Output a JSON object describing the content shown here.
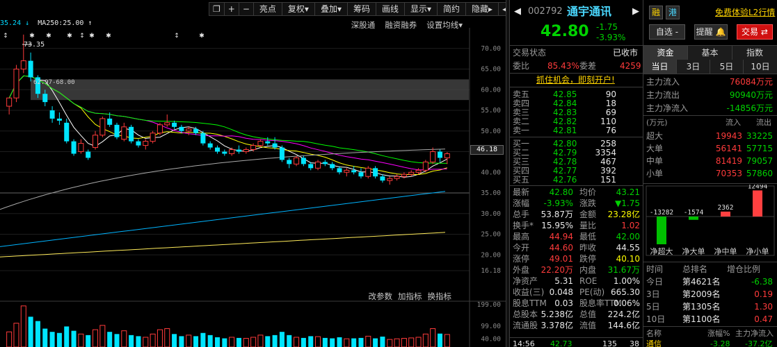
{
  "toolbar": {
    "items": [
      "亮点",
      "复权▾",
      "叠加▾",
      "筹码",
      "画线",
      "显示▾",
      "简约",
      "隐藏▸"
    ],
    "icons": [
      "window-restore-icon",
      "plus-icon",
      "minus-icon"
    ],
    "prev_label": "◂",
    "next_label": "▸"
  },
  "ma_legend": {
    "ma_prefix": "35.24 ↓",
    "ma250": "MA250:25.00 ↑"
  },
  "chart_links": [
    "深股通",
    "融资融券",
    "设置均线▾"
  ],
  "sub_links": [
    "改参数",
    "加指标",
    "换指标"
  ],
  "stock": {
    "code": "002792",
    "name": "通宇通讯",
    "badge1": "融",
    "badge2": "港",
    "price": "42.80",
    "change": "-1.75",
    "change_pct": "-3.93%",
    "promo": "免费体验L2行情",
    "btn_watch": "自选 -",
    "btn_alert": "提醒",
    "btn_trade": "交易"
  },
  "status": {
    "label": "交易状态",
    "value": "已收市",
    "weibi_label": "委比",
    "weibi_value": "85.43%",
    "weicha_label": "委差",
    "weicha_value": "4259",
    "ad": "抓住机会，即刻开户!"
  },
  "order_book": {
    "asks": [
      {
        "label": "卖五",
        "price": "42.85",
        "vol": "90"
      },
      {
        "label": "卖四",
        "price": "42.84",
        "vol": "18"
      },
      {
        "label": "卖三",
        "price": "42.83",
        "vol": "69"
      },
      {
        "label": "卖二",
        "price": "42.82",
        "vol": "110"
      },
      {
        "label": "卖一",
        "price": "42.81",
        "vol": "76"
      }
    ],
    "bids": [
      {
        "label": "买一",
        "price": "42.80",
        "vol": "258"
      },
      {
        "label": "买二",
        "price": "42.79",
        "vol": "3354"
      },
      {
        "label": "买三",
        "price": "42.78",
        "vol": "467"
      },
      {
        "label": "买四",
        "price": "42.77",
        "vol": "392"
      },
      {
        "label": "买五",
        "price": "42.76",
        "vol": "151"
      }
    ]
  },
  "stats": [
    {
      "l1": "最新",
      "v1": "42.80",
      "l2": "均价",
      "v2": "43.21"
    },
    {
      "l1": "涨幅",
      "v1": "-3.93%",
      "l2": "涨跌",
      "v2": "▼1.75"
    },
    {
      "l1": "总手",
      "v1": "53.87万",
      "l2": "金额",
      "v2": "23.28亿"
    },
    {
      "l1": "换手*",
      "v1": "15.95%",
      "l2": "量比",
      "v2": "1.02"
    },
    {
      "l1": "最高",
      "v1": "44.94",
      "l2": "最低",
      "v2": "42.00"
    },
    {
      "l1": "今开",
      "v1": "44.60",
      "l2": "昨收",
      "v2": "44.55"
    },
    {
      "l1": "涨停",
      "v1": "49.01",
      "l2": "跌停",
      "v2": "40.10"
    },
    {
      "l1": "外盘",
      "v1": "22.20万",
      "l2": "内盘",
      "v2": "31.67万"
    },
    {
      "l1": "净资产",
      "v1": "5.31",
      "l2": "ROE",
      "v2": "1.00%"
    },
    {
      "l1": "收益(三)",
      "v1": "0.048",
      "l2": "PE(动)",
      "v2": "665.30"
    },
    {
      "l1": "股息TTM",
      "v1": "0.03",
      "l2": "股息率TTM",
      "v2": "0.06%"
    },
    {
      "l1": "总股本",
      "v1": "5.238亿",
      "l2": "总值",
      "v2": "224.2亿"
    },
    {
      "l1": "流通股",
      "v1": "3.378亿",
      "l2": "流值",
      "v2": "144.6亿"
    }
  ],
  "tick": {
    "time": "14:56",
    "price": "42.73",
    "vol": "135",
    "num": "38"
  },
  "funds": {
    "tabs": [
      "资金",
      "基本",
      "指数"
    ],
    "period_tabs": [
      "当日",
      "3日",
      "5日",
      "10日"
    ],
    "main_in_label": "主力流入",
    "main_in_value": "76084万元",
    "main_out_label": "主力流出",
    "main_out_value": "90940万元",
    "main_net_label": "主力净流入",
    "main_net_value": "-14856万元",
    "table_header": [
      "(万元)",
      "流入",
      "流出"
    ],
    "rows": [
      {
        "label": "超大",
        "in": "19943",
        "out": "33225"
      },
      {
        "label": "大单",
        "in": "56141",
        "out": "57715"
      },
      {
        "label": "中单",
        "in": "81419",
        "out": "79057"
      },
      {
        "label": "小单",
        "in": "70353",
        "out": "57860"
      }
    ],
    "bar_values": [
      -13282,
      -1574,
      2362,
      12494
    ],
    "bar_value_labels": [
      "-13282",
      "-1574",
      "2362",
      "12494"
    ],
    "bar_labels": [
      "净超大",
      "净大单",
      "净中单",
      "净小单"
    ]
  },
  "rank": {
    "header": [
      "时间",
      "总排名",
      "增仓比例"
    ],
    "rows": [
      {
        "period": "今日",
        "rank": "第4621名",
        "ratio": "-6.38"
      },
      {
        "period": "3日",
        "rank": "第2009名",
        "ratio": "0.19"
      },
      {
        "period": "5日",
        "rank": "第1305名",
        "ratio": "1.30"
      },
      {
        "period": "10日",
        "rank": "第1100名",
        "ratio": "0.47"
      }
    ],
    "footer_name": "名称",
    "footer_change": "涨幅%",
    "footer_flow": "主力净流入",
    "footer_row": {
      "name": "通信",
      "change": "-3.28",
      "flow": "-37.2亿"
    }
  },
  "axis": {
    "price_ticks": [
      "70.00",
      "65.00",
      "60.00",
      "55.00",
      "50.00",
      "45.00",
      "40.00",
      "35.00",
      "30.00",
      "25.00",
      "20.00",
      "16.18"
    ],
    "current_tag": "46.18",
    "vol_ticks": [
      "199.00",
      "99.00",
      "40.00"
    ],
    "high_label": "73.35",
    "range_label": "62.97-68.00"
  },
  "colors": {
    "up": "#ff3b3b",
    "down": "#00e5ff",
    "ma5": "#ffffff",
    "ma10": "#ffff00",
    "ma20": "#ff00ff",
    "ma30": "#00ff00",
    "ma60": "#aaaaaa",
    "ma120": "#00b4ff",
    "ma250": "#ffeb5a"
  },
  "chart_data": {
    "type": "candlestick",
    "title": "",
    "xlabel": "",
    "ylabel": "",
    "ylim": [
      16.18,
      75
    ],
    "candles": [
      {
        "o": 56,
        "h": 58,
        "l": 54,
        "c": 58
      },
      {
        "o": 58,
        "h": 66,
        "l": 57,
        "c": 65
      },
      {
        "o": 65,
        "h": 73.35,
        "l": 64,
        "c": 67
      },
      {
        "o": 67,
        "h": 69,
        "l": 62,
        "c": 63
      },
      {
        "o": 63,
        "h": 63.5,
        "l": 58,
        "c": 59
      },
      {
        "o": 59,
        "h": 60,
        "l": 56,
        "c": 57
      },
      {
        "o": 55,
        "h": 56,
        "l": 52,
        "c": 53
      },
      {
        "o": 53,
        "h": 54.5,
        "l": 51.5,
        "c": 52.5
      },
      {
        "o": 52,
        "h": 53,
        "l": 47,
        "c": 47.5
      },
      {
        "o": 47.5,
        "h": 48,
        "l": 44,
        "c": 44.5
      },
      {
        "o": 45,
        "h": 48,
        "l": 44.5,
        "c": 47
      },
      {
        "o": 45,
        "h": 45.5,
        "l": 43,
        "c": 43.5
      },
      {
        "o": 46,
        "h": 50,
        "l": 45.5,
        "c": 49
      },
      {
        "o": 49,
        "h": 53.5,
        "l": 48.5,
        "c": 53
      },
      {
        "o": 53,
        "h": 54.5,
        "l": 51,
        "c": 51.5
      },
      {
        "o": 51.5,
        "h": 52,
        "l": 48,
        "c": 48.5
      },
      {
        "o": 48,
        "h": 52,
        "l": 47.5,
        "c": 51
      },
      {
        "o": 51,
        "h": 51.5,
        "l": 47,
        "c": 47.5
      },
      {
        "o": 47.5,
        "h": 48,
        "l": 46,
        "c": 46.5
      },
      {
        "o": 46.5,
        "h": 48,
        "l": 45.5,
        "c": 47.5
      },
      {
        "o": 47.5,
        "h": 50,
        "l": 47,
        "c": 49.5
      },
      {
        "o": 49.5,
        "h": 52,
        "l": 49,
        "c": 51.5
      },
      {
        "o": 51.5,
        "h": 54,
        "l": 51,
        "c": 52
      },
      {
        "o": 52,
        "h": 52.5,
        "l": 50.5,
        "c": 51
      },
      {
        "o": 51,
        "h": 51.5,
        "l": 49.5,
        "c": 50
      },
      {
        "o": 50,
        "h": 51,
        "l": 49,
        "c": 50.5
      },
      {
        "o": 50.5,
        "h": 51,
        "l": 49,
        "c": 49.5
      },
      {
        "o": 49.5,
        "h": 50,
        "l": 46.5,
        "c": 47
      },
      {
        "o": 47,
        "h": 47.5,
        "l": 45.5,
        "c": 46
      },
      {
        "o": 46,
        "h": 46.5,
        "l": 44.5,
        "c": 45
      },
      {
        "o": 45,
        "h": 45.5,
        "l": 44,
        "c": 44.5
      },
      {
        "o": 44.5,
        "h": 46,
        "l": 44,
        "c": 45.5
      },
      {
        "o": 45.5,
        "h": 46.5,
        "l": 44.5,
        "c": 45
      },
      {
        "o": 45,
        "h": 46,
        "l": 44.5,
        "c": 45.5
      },
      {
        "o": 45.5,
        "h": 47,
        "l": 45,
        "c": 46.5
      },
      {
        "o": 46.5,
        "h": 48,
        "l": 46,
        "c": 47.5
      },
      {
        "o": 47.5,
        "h": 48.5,
        "l": 46.5,
        "c": 47
      },
      {
        "o": 47,
        "h": 48.5,
        "l": 45.5,
        "c": 46
      },
      {
        "o": 46,
        "h": 46.5,
        "l": 42.5,
        "c": 43
      },
      {
        "o": 43,
        "h": 43.5,
        "l": 41,
        "c": 42
      },
      {
        "o": 42,
        "h": 44,
        "l": 41.5,
        "c": 43.5
      },
      {
        "o": 43.5,
        "h": 44,
        "l": 41.5,
        "c": 42
      },
      {
        "o": 42,
        "h": 42.5,
        "l": 40.5,
        "c": 41
      },
      {
        "o": 41,
        "h": 43,
        "l": 40.5,
        "c": 42.5
      },
      {
        "o": 42.5,
        "h": 43,
        "l": 41.5,
        "c": 42
      },
      {
        "o": 42,
        "h": 42.5,
        "l": 40.5,
        "c": 41
      },
      {
        "o": 41,
        "h": 41.5,
        "l": 39.5,
        "c": 40
      },
      {
        "o": 40,
        "h": 41,
        "l": 39,
        "c": 40.5
      },
      {
        "o": 40.5,
        "h": 41.5,
        "l": 39.5,
        "c": 40
      },
      {
        "o": 40,
        "h": 41,
        "l": 38.5,
        "c": 39
      },
      {
        "o": 39,
        "h": 41.5,
        "l": 38.5,
        "c": 41
      },
      {
        "o": 41,
        "h": 41.5,
        "l": 38.5,
        "c": 39
      },
      {
        "o": 39,
        "h": 39.5,
        "l": 37.5,
        "c": 38
      },
      {
        "o": 38,
        "h": 39,
        "l": 37,
        "c": 38.5
      },
      {
        "o": 38.5,
        "h": 39.5,
        "l": 38,
        "c": 39
      },
      {
        "o": 39,
        "h": 40,
        "l": 38.5,
        "c": 39.5
      },
      {
        "o": 39.5,
        "h": 40.5,
        "l": 39,
        "c": 40
      },
      {
        "o": 40,
        "h": 41,
        "l": 39.5,
        "c": 40.5
      },
      {
        "o": 40.5,
        "h": 43,
        "l": 40,
        "c": 42.5
      },
      {
        "o": 42.5,
        "h": 46,
        "l": 42,
        "c": 45
      },
      {
        "o": 45,
        "h": 45.5,
        "l": 42.5,
        "c": 43.5
      },
      {
        "o": 43.5,
        "h": 44.9,
        "l": 42,
        "c": 44.5
      }
    ],
    "volumes": [
      70,
      110,
      190,
      140,
      120,
      85,
      70,
      65,
      95,
      75,
      60,
      55,
      80,
      100,
      70,
      60,
      75,
      55,
      50,
      45,
      60,
      80,
      85,
      60,
      50,
      55,
      50,
      65,
      55,
      45,
      40,
      45,
      42,
      40,
      45,
      55,
      50,
      55,
      70,
      55,
      45,
      42,
      50,
      48,
      42,
      40,
      45,
      38,
      40,
      42,
      50,
      40,
      48,
      35,
      38,
      40,
      42,
      45,
      60,
      85,
      62,
      58
    ],
    "gray_band": [
      57.5,
      62.5
    ]
  }
}
